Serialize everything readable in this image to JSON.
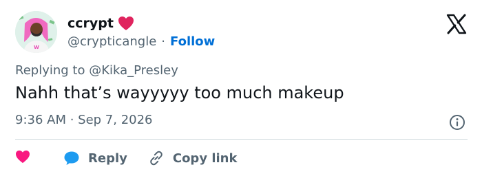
{
  "user": {
    "display_name": "ccrypt",
    "handle": "@crypticangle",
    "follow_label": "Follow",
    "separator": "·"
  },
  "tweet": {
    "replying_to": "Replying to @Kika_Presley",
    "text": "Nahh that’s wayyyyy too much makeup",
    "timestamp": "9:36 AM · Sep 7, 2026"
  },
  "actions": {
    "reply_label": "Reply",
    "copy_link_label": "Copy link"
  },
  "icons": {
    "name_badge": "red-heart-icon",
    "brand": "x-logo-icon",
    "info": "info-icon",
    "like": "heart-icon",
    "reply": "speech-bubble-icon",
    "copy_link": "link-icon"
  },
  "colors": {
    "like": "#f91880",
    "reply": "#1d9bf0",
    "link": "#006fd6",
    "secondary_text": "#536471",
    "text": "#0f1419",
    "heart_badge": "#e0245e"
  }
}
